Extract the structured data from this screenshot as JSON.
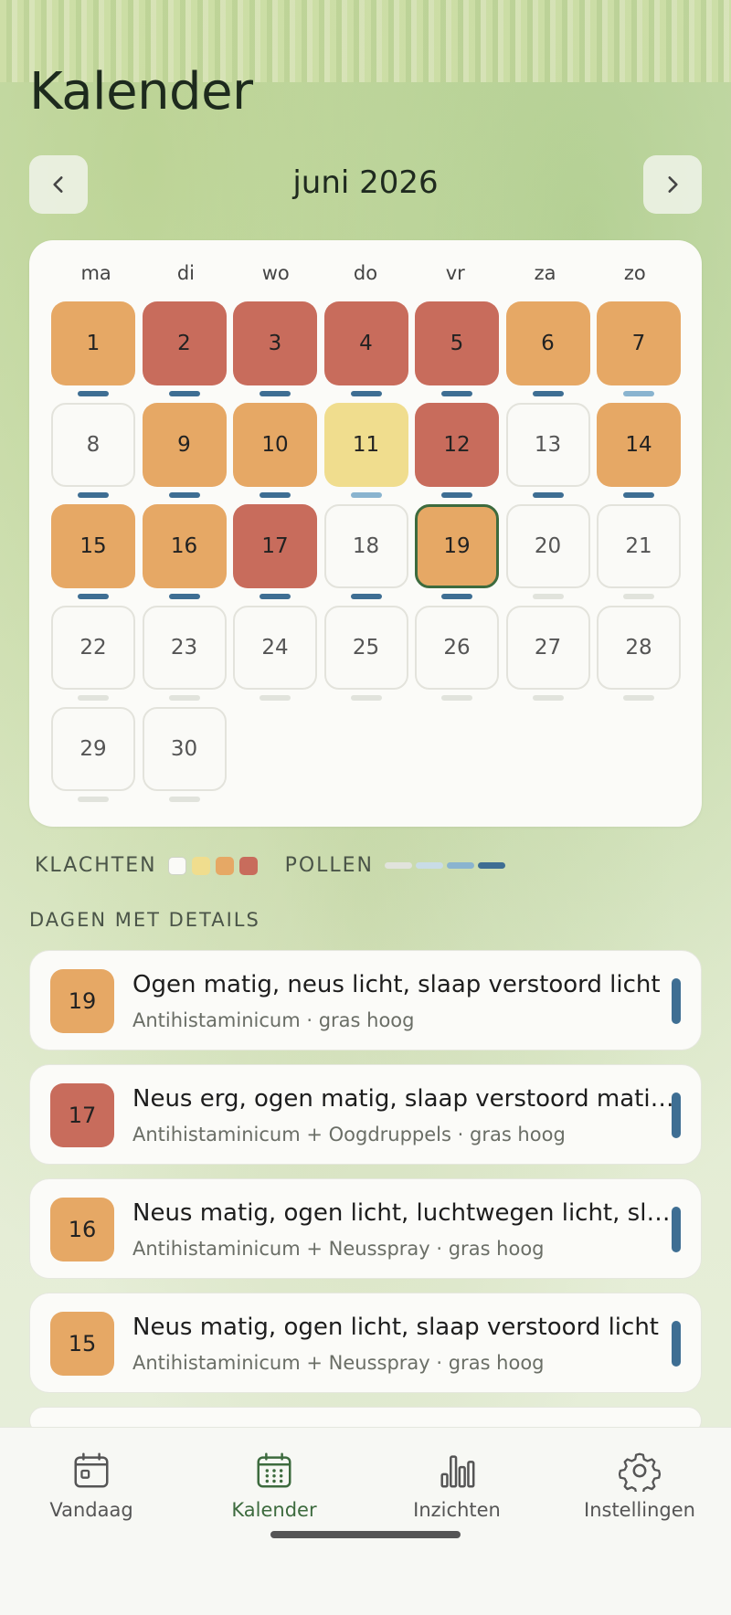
{
  "page_title": "Kalender",
  "month_label": "juni 2026",
  "weekdays": [
    "ma",
    "di",
    "wo",
    "do",
    "vr",
    "za",
    "zo"
  ],
  "colors": {
    "none": "#fafaf7",
    "licht": "#f0dd8e",
    "matig": "#e6a865",
    "erg": "#c86c5c",
    "pollen_none": "#e1e3dc",
    "pollen_laag": "#c9dce6",
    "pollen_matig": "#8ab4cf",
    "pollen_hoog": "#3e6e93",
    "accent": "#3d6b3e"
  },
  "days": [
    {
      "n": "1",
      "level": "matig",
      "pollen": "hoog"
    },
    {
      "n": "2",
      "level": "erg",
      "pollen": "hoog"
    },
    {
      "n": "3",
      "level": "erg",
      "pollen": "hoog"
    },
    {
      "n": "4",
      "level": "erg",
      "pollen": "hoog"
    },
    {
      "n": "5",
      "level": "erg",
      "pollen": "hoog"
    },
    {
      "n": "6",
      "level": "matig",
      "pollen": "hoog"
    },
    {
      "n": "7",
      "level": "matig",
      "pollen": "matig"
    },
    {
      "n": "8",
      "level": "none",
      "pollen": "hoog"
    },
    {
      "n": "9",
      "level": "matig",
      "pollen": "hoog"
    },
    {
      "n": "10",
      "level": "matig",
      "pollen": "hoog"
    },
    {
      "n": "11",
      "level": "licht",
      "pollen": "matig"
    },
    {
      "n": "12",
      "level": "erg",
      "pollen": "hoog"
    },
    {
      "n": "13",
      "level": "none",
      "pollen": "hoog"
    },
    {
      "n": "14",
      "level": "matig",
      "pollen": "hoog"
    },
    {
      "n": "15",
      "level": "matig",
      "pollen": "hoog"
    },
    {
      "n": "16",
      "level": "matig",
      "pollen": "hoog"
    },
    {
      "n": "17",
      "level": "erg",
      "pollen": "hoog"
    },
    {
      "n": "18",
      "level": "none",
      "pollen": "hoog"
    },
    {
      "n": "19",
      "level": "matig",
      "pollen": "hoog",
      "today": true
    },
    {
      "n": "20",
      "level": "none",
      "pollen": "none"
    },
    {
      "n": "21",
      "level": "none",
      "pollen": "none"
    },
    {
      "n": "22",
      "level": "none",
      "pollen": "none"
    },
    {
      "n": "23",
      "level": "none",
      "pollen": "none"
    },
    {
      "n": "24",
      "level": "none",
      "pollen": "none"
    },
    {
      "n": "25",
      "level": "none",
      "pollen": "none"
    },
    {
      "n": "26",
      "level": "none",
      "pollen": "none"
    },
    {
      "n": "27",
      "level": "none",
      "pollen": "none"
    },
    {
      "n": "28",
      "level": "none",
      "pollen": "none"
    },
    {
      "n": "29",
      "level": "none",
      "pollen": "none"
    },
    {
      "n": "30",
      "level": "none",
      "pollen": "none"
    }
  ],
  "legend": {
    "klachten_label": "KLACHTEN",
    "pollen_label": "POLLEN"
  },
  "details_label": "DAGEN MET DETAILS",
  "details": [
    {
      "n": "19",
      "level": "matig",
      "title": "Ogen matig, neus licht, slaap verstoord licht",
      "sub": "Antihistaminicum · gras hoog"
    },
    {
      "n": "17",
      "level": "erg",
      "title": "Neus erg, ogen matig, slaap verstoord matig…",
      "sub": "Antihistaminicum + Oogdruppels · gras hoog"
    },
    {
      "n": "16",
      "level": "matig",
      "title": "Neus matig, ogen licht, luchtwegen licht, sla…",
      "sub": "Antihistaminicum + Neusspray · gras hoog"
    },
    {
      "n": "15",
      "level": "matig",
      "title": "Neus matig, ogen licht, slaap verstoord licht",
      "sub": "Antihistaminicum + Neusspray · gras hoog"
    }
  ],
  "tabs": [
    {
      "label": "Vandaag",
      "icon": "calendar-day-icon"
    },
    {
      "label": "Kalender",
      "icon": "calendar-grid-icon",
      "active": true
    },
    {
      "label": "Inzichten",
      "icon": "bar-chart-icon"
    },
    {
      "label": "Instellingen",
      "icon": "gear-icon"
    }
  ]
}
